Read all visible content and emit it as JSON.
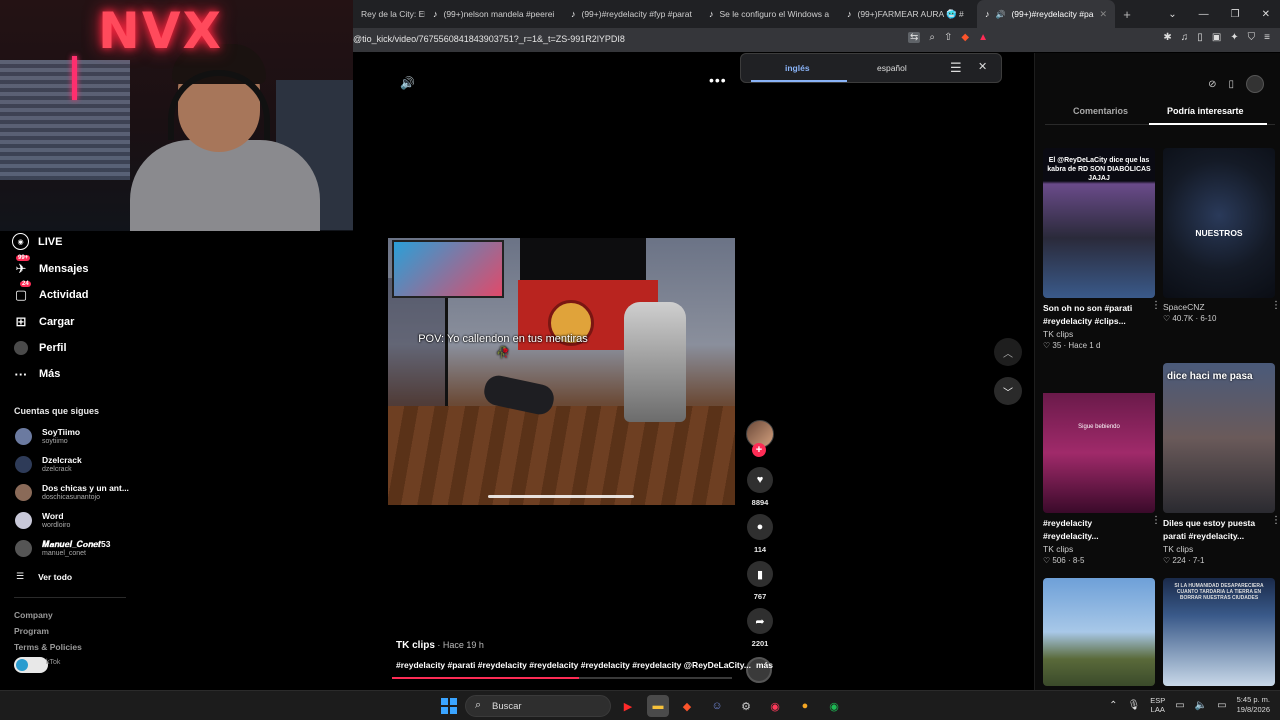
{
  "stream": {
    "neon_sign": "NVX"
  },
  "browser": {
    "tabs": [
      {
        "label": "Rey de la City: El"
      },
      {
        "label": "(99+)nelson mandela #peerei"
      },
      {
        "label": "(99+)#reydelacity #fyp #parat"
      },
      {
        "label": "Se le configuro el Windows a"
      },
      {
        "label": "(99+)FARMEAR AURA 🥶 #"
      },
      {
        "label": "(99+)#reydelacity #pa"
      }
    ],
    "url": "@tio_kick/video/7675560841843903751?_r=1&_t=ZS-991R2lYPDI8"
  },
  "translate": {
    "lang_from": "inglés",
    "lang_to": "español"
  },
  "sidebar": {
    "nav": [
      {
        "label": "LIVE",
        "icon": "live-icon"
      },
      {
        "label": "Mensajes",
        "icon": "messages-icon",
        "badge": "99+"
      },
      {
        "label": "Actividad",
        "icon": "activity-icon",
        "badge": "24"
      },
      {
        "label": "Cargar",
        "icon": "upload-icon"
      },
      {
        "label": "Perfil",
        "icon": "profile-icon"
      },
      {
        "label": "Más",
        "icon": "more-icon"
      }
    ],
    "following_title": "Cuentas que sigues",
    "following": [
      {
        "name": "SoyTiimo",
        "user": "soytiimo"
      },
      {
        "name": "Dzelcrack",
        "user": "dzelcrack"
      },
      {
        "name": "Dos chicas y un ant...",
        "user": "doschicasunantojo"
      },
      {
        "name": "Word",
        "user": "wordloiro"
      },
      {
        "name": "𝑴𝒂𝒏𝒖𝒆𝒍_𝑪𝒐𝒏𝒆𝒕53",
        "user": "manuel_conet"
      }
    ],
    "see_all": "Ver todo",
    "footer": [
      "Company",
      "Program",
      "Terms & Policies"
    ],
    "toggle_label": "kTok"
  },
  "video": {
    "caption": "POV: Yo callendon en tus mentiras 🥀",
    "author": "TK clips",
    "time": " · Hace 19 h",
    "description": "#reydelacity #parati #reydelacity #reydelacity #reydelacity #reydelacity @ReyDeLaCity...",
    "more": "más",
    "progress": 0.55,
    "likes": "8894",
    "comments": "114",
    "saves": "767",
    "shares": "2201"
  },
  "right_panel": {
    "tabs": [
      "Comentarios",
      "Podría interesarte"
    ],
    "cards": [
      {
        "thumb_text": "El @ReyDeLaCity dice que las kabra de RD SON DIABÓLICAS JAJAJ",
        "title": "Son oh no son #parati #reydelacity #clips...",
        "author": "TK clips",
        "meta": "♡ 35 · Hace 1 d"
      },
      {
        "thumb_text": "NUESTROS",
        "title": "",
        "author": "SpaceCNZ",
        "meta": "♡ 40.7K · 6-10"
      },
      {
        "thumb_text": "Sigue bebiendo",
        "title": "#reydelacity #reydelacity...",
        "author": "TK clips",
        "meta": "♡ 506 · 8-5"
      },
      {
        "thumb_text": "dice haci me pasa",
        "title": "Diles que estoy puesta parati #reydelacity...",
        "author": "TK clips",
        "meta": "♡ 224 · 7-1"
      },
      {
        "thumb_text": "",
        "title": "",
        "author": "",
        "meta": ""
      },
      {
        "thumb_text": "SI LA HUMANIDAD DESAPARECIERA CUANTO TARDARIA LA TIERRA EN BORRAR NUESTRAS CIUDADES",
        "title": "",
        "author": "",
        "meta": ""
      }
    ]
  },
  "taskbar": {
    "search": "Buscar",
    "lang_top": "ESP",
    "lang_bottom": "LAA",
    "time": "5:45 p. m.",
    "date": "19/8/2026"
  },
  "colors": {
    "accent": "#fe2c55",
    "link": "#8ab4f8"
  }
}
